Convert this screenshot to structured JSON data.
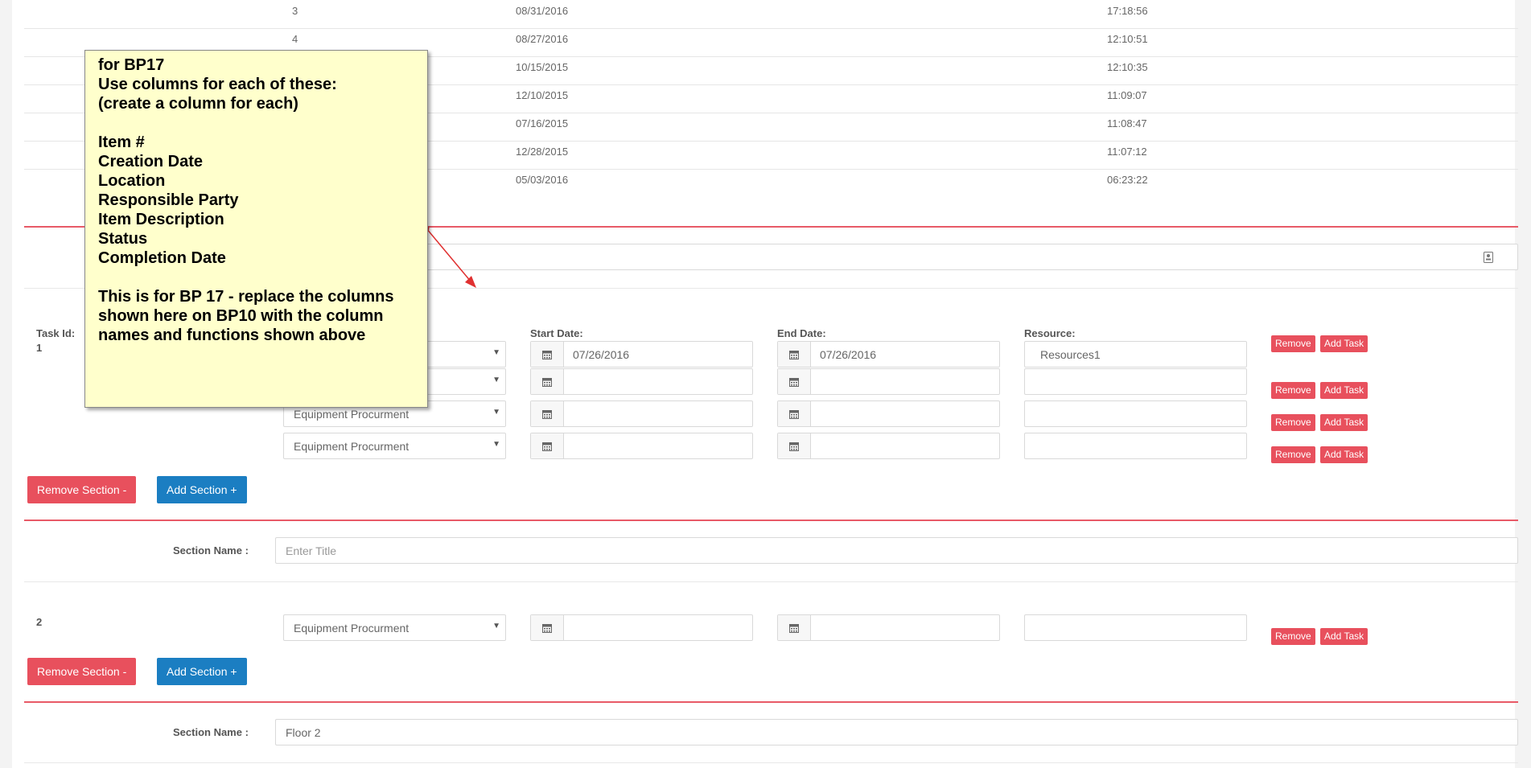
{
  "table_rows": [
    {
      "num": "3",
      "date": "08/31/2016",
      "time": "17:18:56"
    },
    {
      "num": "4",
      "date": "08/27/2016",
      "time": "12:10:51"
    },
    {
      "num": "",
      "date": "10/15/2015",
      "time": "12:10:35"
    },
    {
      "num": "",
      "date": "12/10/2015",
      "time": "11:09:07"
    },
    {
      "num": "",
      "date": "07/16/2015",
      "time": "11:08:47"
    },
    {
      "num": "",
      "date": "12/28/2015",
      "time": "11:07:12"
    },
    {
      "num": "",
      "date": "05/03/2016",
      "time": "06:23:22"
    }
  ],
  "section1": {
    "task_id_label": "Task Id:",
    "task_id": "1",
    "start_label": "Start Date:",
    "end_label": "End Date:",
    "resource_label": "Resource:",
    "tasks": [
      {
        "type": "",
        "start": "07/26/2016",
        "end": "07/26/2016",
        "resource": "Resources1"
      },
      {
        "type": "",
        "start": "",
        "end": "",
        "resource": ""
      },
      {
        "type": "Equipment Procurment",
        "start": "",
        "end": "",
        "resource": ""
      },
      {
        "type": "Equipment Procurment",
        "start": "",
        "end": "",
        "resource": ""
      }
    ],
    "remove_label": "Remove",
    "add_task_label": "Add Task",
    "remove_section_label": "Remove Section -",
    "add_section_label": "Add Section +"
  },
  "section2": {
    "section_name_label": "Section Name :",
    "section_name_placeholder": "Enter Title",
    "task_id": "2",
    "tasks": [
      {
        "type": "Equipment Procurment",
        "start": "",
        "end": "",
        "resource": ""
      }
    ],
    "remove_label": "Remove",
    "add_task_label": "Add Task",
    "remove_section_label": "Remove Section -",
    "add_section_label": "Add Section +"
  },
  "section3": {
    "section_name_label": "Section Name :",
    "section_name_value": "Floor 2"
  },
  "note": {
    "lines": [
      "for BP17",
      "Use columns for each of these:",
      "(create a column for each)",
      "",
      "Item #",
      "Creation Date",
      "Location",
      "Responsible Party",
      "Item Description",
      "Status",
      "Completion Date",
      "",
      "This is for BP 17 - replace the columns",
      "shown here on BP10 with the column",
      "names and functions shown above"
    ]
  },
  "colors": {
    "accent_red": "#e8505d",
    "accent_blue": "#1b7ec2",
    "note_bg": "#ffffcc"
  },
  "icons": {
    "calendar": "calendar-icon",
    "caret": "caret-down-icon",
    "field_icon": "contact-card-icon"
  }
}
